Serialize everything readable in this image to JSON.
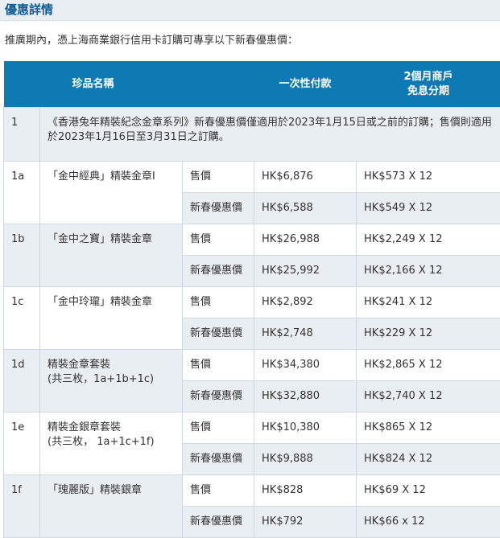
{
  "section": {
    "title": "優惠詳情",
    "intro": "推廣期內，憑上海商業銀行信用卡訂購可專享以下新春優惠價："
  },
  "table": {
    "headers": {
      "name": "珍品名稱",
      "lump_sum": "一次性付款",
      "instalment_line1": "2個月商戶",
      "instalment_line2": "免息分期"
    },
    "note": {
      "id": "1",
      "text": "《香港兔年精裝紀念金章系列》新春優惠價僅適用於2023年1月15日或之前的訂購；售價則適用於2023年1月16日至3月31日之訂購。"
    },
    "items": [
      {
        "id": "1a",
        "name_line1": "「金中經典」精裝金章I",
        "name_line2": "",
        "rows": [
          {
            "type": "售價",
            "price": "HK$6,876",
            "instalment": "HK$573 X 12"
          },
          {
            "type": "新春優惠價",
            "price": "HK$6,588",
            "instalment": "HK$549 X 12"
          }
        ]
      },
      {
        "id": "1b",
        "name_line1": "「金中之寶」精裝金章",
        "name_line2": "",
        "rows": [
          {
            "type": "售價",
            "price": "HK$26,988",
            "instalment": "HK$2,249 X 12"
          },
          {
            "type": "新春優惠價",
            "price": "HK$25,992",
            "instalment": "HK$2,166 X 12"
          }
        ]
      },
      {
        "id": "1c",
        "name_line1": "「金中玲瓏」精裝金章",
        "name_line2": "",
        "rows": [
          {
            "type": "售價",
            "price": "HK$2,892",
            "instalment": "HK$241 X 12"
          },
          {
            "type": "新春優惠價",
            "price": "HK$2,748",
            "instalment": "HK$229 X 12"
          }
        ]
      },
      {
        "id": "1d",
        "name_line1": "精裝金章套裝",
        "name_line2": "(共三枚，1a+1b+1c)",
        "rows": [
          {
            "type": "售價",
            "price": "HK$34,380",
            "instalment": "HK$2,865 X 12"
          },
          {
            "type": "新春優惠價",
            "price": "HK$32,880",
            "instalment": "HK$2,740 X 12"
          }
        ]
      },
      {
        "id": "1e",
        "name_line1": "精裝金銀章套裝",
        "name_line2": "(共三枚， 1a+1c+1f)",
        "rows": [
          {
            "type": "售價",
            "price": "HK$10,380",
            "instalment": "HK$865 X 12"
          },
          {
            "type": "新春優惠價",
            "price": "HK$9,888",
            "instalment": "HK$824 X 12"
          }
        ]
      },
      {
        "id": "1f",
        "name_line1": "「瑰麗版」精裝銀章",
        "name_line2": "",
        "rows": [
          {
            "type": "售價",
            "price": "HK$828",
            "instalment": "HK$69 X 12"
          },
          {
            "type": "新春優惠價",
            "price": "HK$792",
            "instalment": "HK$66 x 12"
          }
        ]
      }
    ]
  }
}
